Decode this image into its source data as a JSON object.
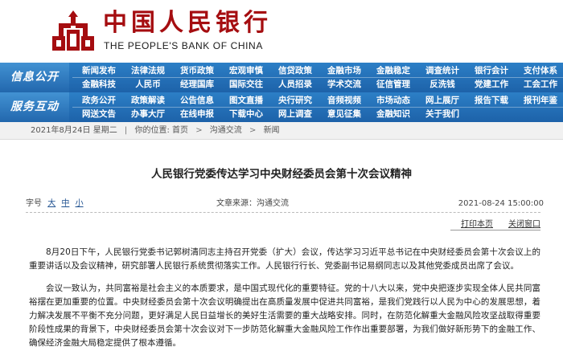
{
  "header": {
    "title_cn": "中国人民银行",
    "title_en": "THE PEOPLE'S BANK OF CHINA",
    "brand_color": "#a50d10",
    "nav_color": "#1d62a9"
  },
  "nav": {
    "sections": [
      {
        "label": "信息公开",
        "top": [
          "新闻发布",
          "法律法规",
          "货币政策",
          "宏观审慎",
          "信贷政策",
          "金融市场",
          "金融稳定",
          "调查统计",
          "银行会计",
          "支付体系"
        ],
        "bottom": [
          "金融科技",
          "人民币",
          "经理国库",
          "国际交往",
          "人员招录",
          "学术交流",
          "征信管理",
          "反洗钱",
          "党建工作",
          "工会工作"
        ]
      },
      {
        "label": "服务互动",
        "top": [
          "政务公开",
          "政策解读",
          "公告信息",
          "图文直播",
          "央行研究",
          "音频视频",
          "市场动态",
          "网上展厅",
          "报告下载",
          "报刊年鉴"
        ],
        "bottom": [
          "网送文告",
          "办事大厅",
          "在线申报",
          "下载中心",
          "网上调查",
          "意见征集",
          "金融知识",
          "关于我们",
          "",
          ""
        ]
      }
    ]
  },
  "breadcrumb": {
    "date": "2021年8月24日 星期二",
    "you_are_here": "你的位置:",
    "items": [
      "首页",
      "沟通交流",
      "新闻"
    ]
  },
  "article": {
    "title": "人民银行党委传达学习中央财经委员会第十次会议精神",
    "font_label": "字号",
    "font_sizes": [
      "大",
      "中",
      "小"
    ],
    "source_label": "文章来源：",
    "source": "沟通交流",
    "datetime": "2021-08-24 15:00:00",
    "print_label": "打印本页",
    "close_label": "关闭窗口",
    "paragraphs": [
      "8月20日下午，人民银行党委书记郭树清同志主持召开党委（扩大）会议，传达学习习近平总书记在中央财经委员会第十次会议上的重要讲话以及会议精神，研究部署人民银行系统贯彻落实工作。人民银行行长、党委副书记易纲同志以及其他党委成员出席了会议。",
      "会议一致认为，共同富裕是社会主义的本质要求，是中国式现代化的重要特征。党的十八大以来，党中央把逐步实现全体人民共同富裕摆在更加重要的位置。中央财经委员会第十次会议明确提出在高质量发展中促进共同富裕，是我们党践行以人民为中心的发展思想，着力解决发展不平衡不充分问题，更好满足人民日益增长的美好生活需要的重大战略安排。同时，在防范化解重大金融风险攻坚战取得重要阶段性成果的背景下，中央财经委员会第十次会议对下一步防范化解重大金融风险工作作出重要部署，为我们做好新形势下的金融工作、确保经济金融大局稳定提供了根本遵循。"
    ]
  }
}
